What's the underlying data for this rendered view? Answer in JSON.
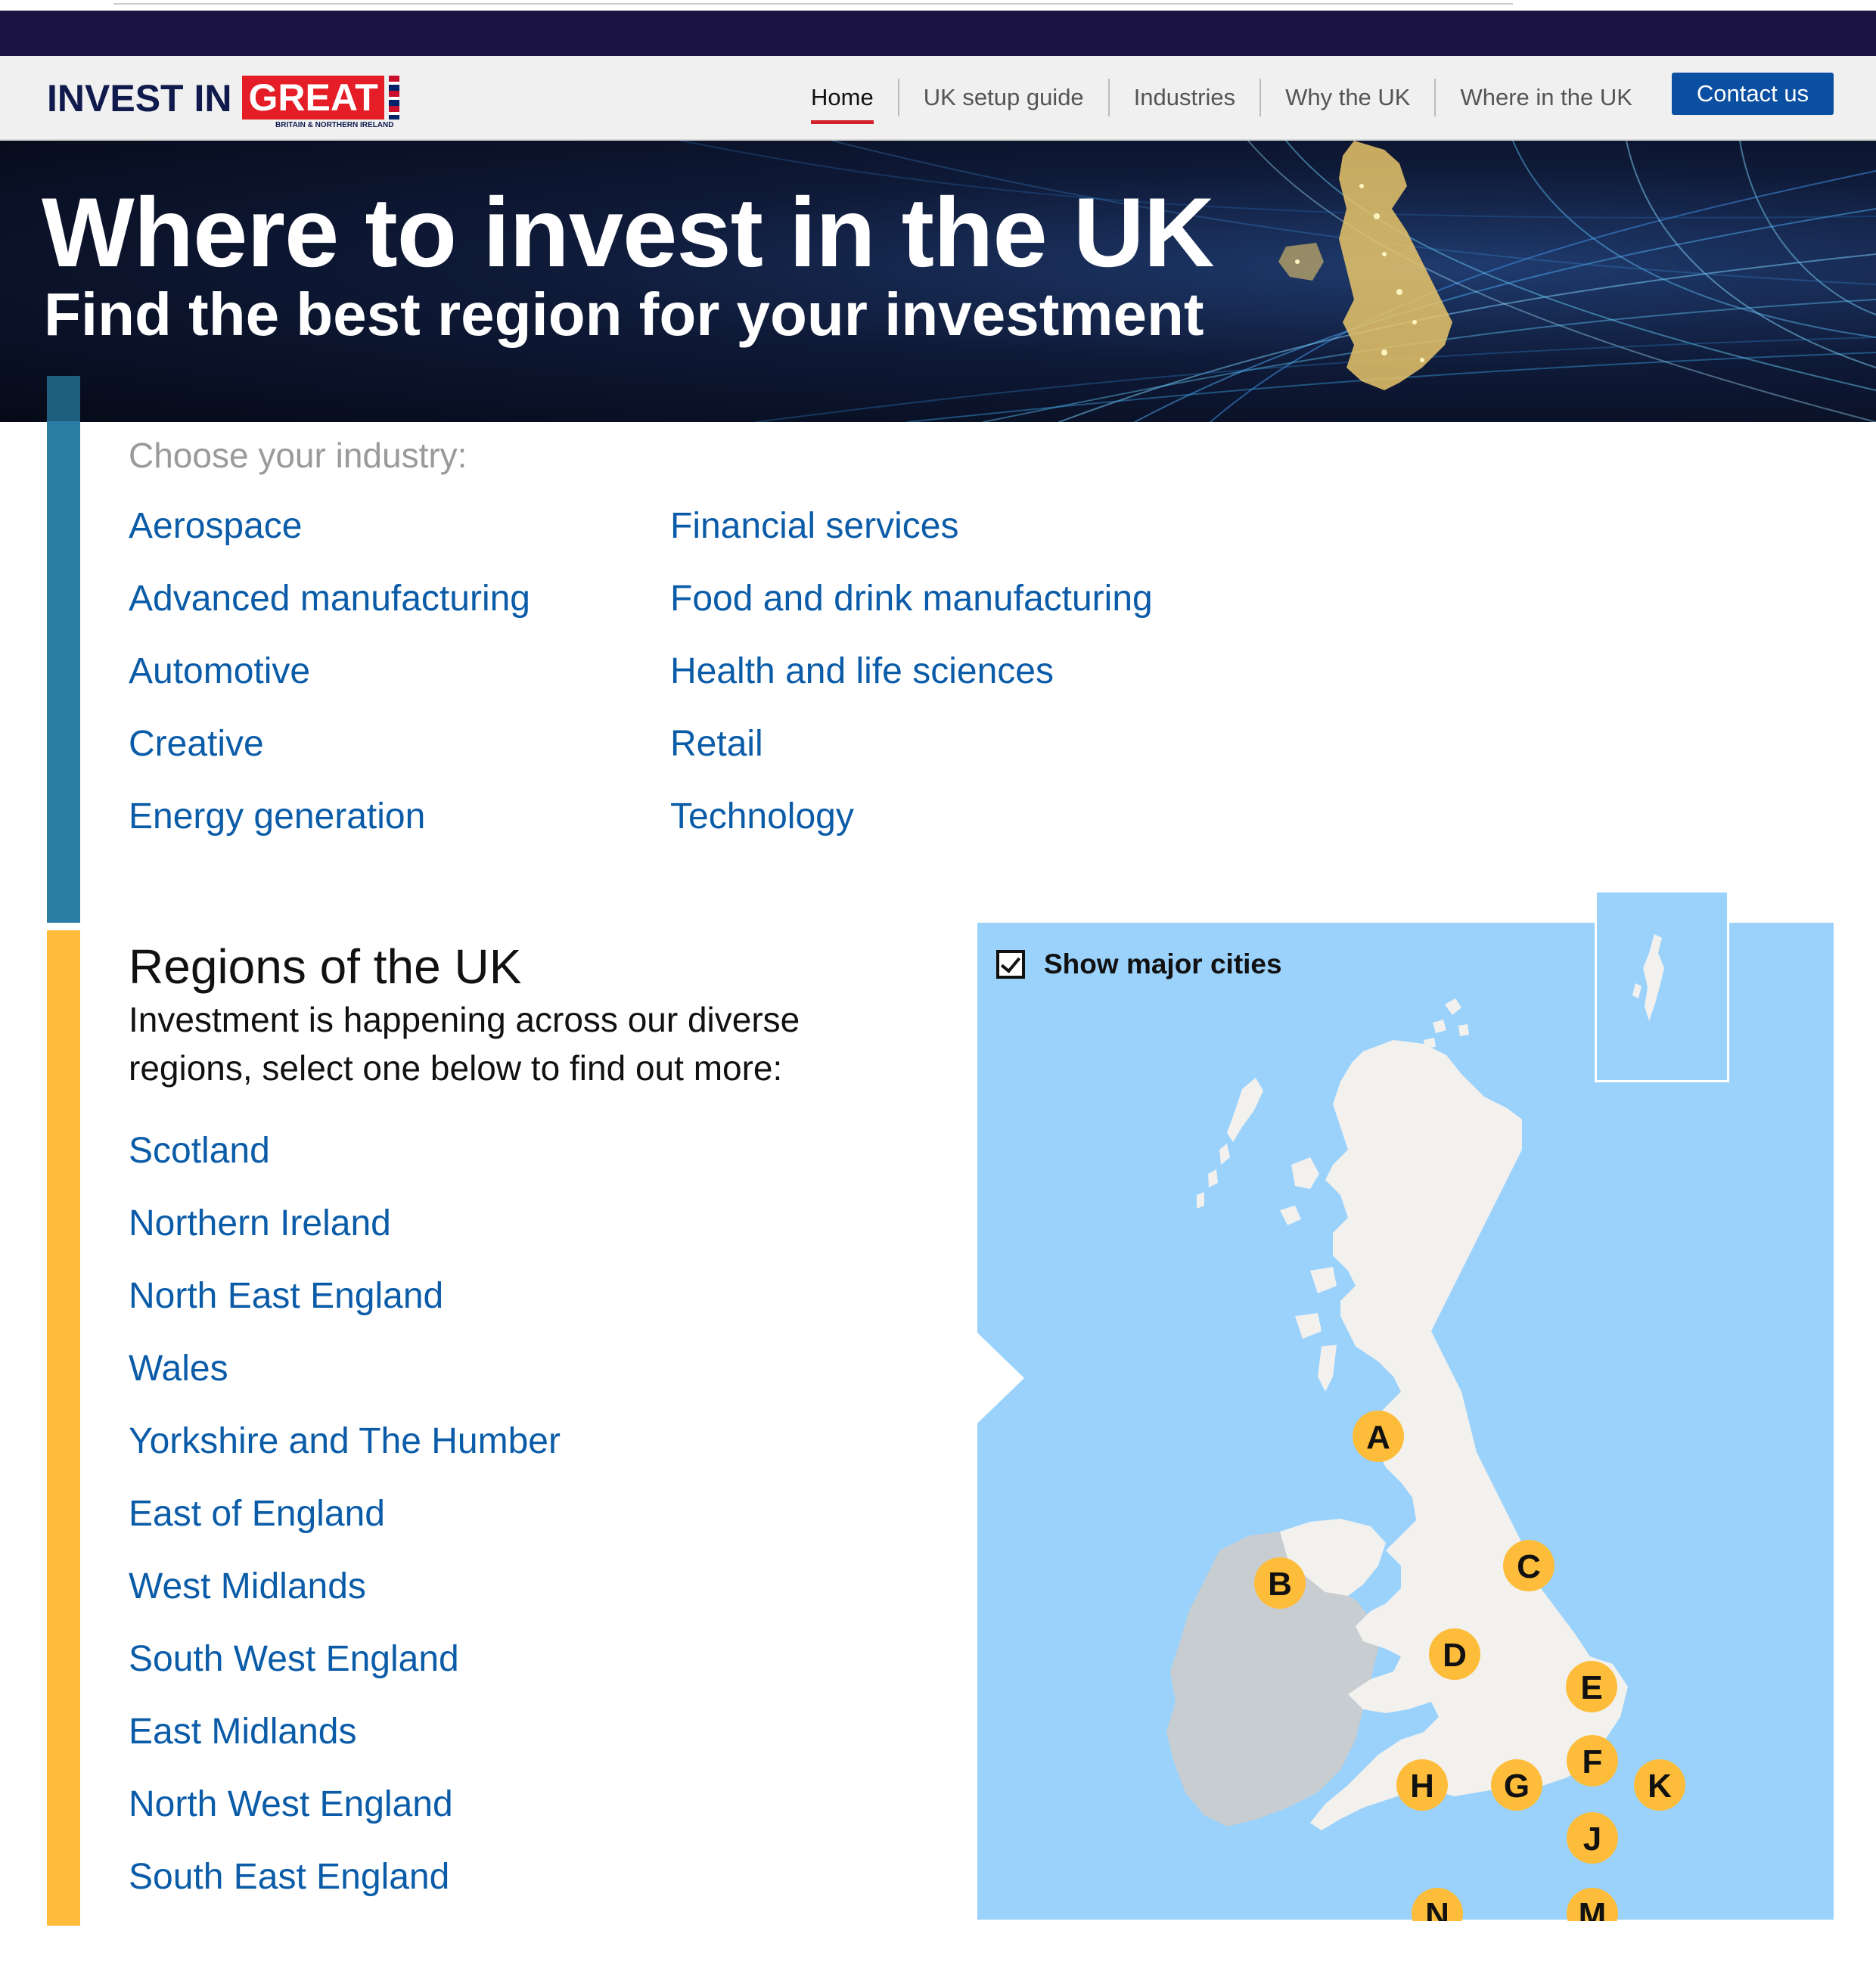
{
  "brand": {
    "invest": "INVEST IN",
    "great": "GREAT",
    "subtitle": "BRITAIN & NORTHERN IRELAND"
  },
  "nav": {
    "items": [
      {
        "label": "Home",
        "active": true
      },
      {
        "label": "UK setup guide"
      },
      {
        "label": "Industries"
      },
      {
        "label": "Why the UK"
      },
      {
        "label": "Where in the UK"
      }
    ],
    "contact_label": "Contact us"
  },
  "hero": {
    "title": "Where to invest in the UK",
    "subtitle": "Find the best region for your investment"
  },
  "industries": {
    "label": "Choose your industry:",
    "col1": [
      "Aerospace",
      "Advanced manufacturing",
      "Automotive",
      "Creative",
      "Energy generation"
    ],
    "col2": [
      "Financial services",
      "Food and drink manufacturing",
      "Health and life sciences",
      "Retail",
      "Technology"
    ]
  },
  "regions": {
    "title": "Regions of the UK",
    "intro": "Investment is happening across our diverse regions, select one below to find out more:",
    "list": [
      "Scotland",
      "Northern Ireland",
      "North East England",
      "Wales",
      "Yorkshire and The Humber",
      "East of England",
      "West Midlands",
      "South West England",
      "East Midlands",
      "North West England",
      "South East England"
    ]
  },
  "map": {
    "checkbox_label": "Show major cities",
    "checked": true,
    "markers": [
      "A",
      "B",
      "C",
      "D",
      "E",
      "F",
      "G",
      "H",
      "J",
      "K",
      "M",
      "N"
    ],
    "colors": {
      "water": "#9ad2fc",
      "land": "#f2f1ee",
      "ireland": "#c8cdd1",
      "marker": "#fdbd3a"
    }
  },
  "colors": {
    "navy": "#1b1442",
    "link": "#0b5ca8",
    "contact": "#0a4fa1",
    "accent_red": "#d4212b",
    "bar_blue": "#2a7ea6",
    "bar_yellow": "#fdbd3a"
  }
}
